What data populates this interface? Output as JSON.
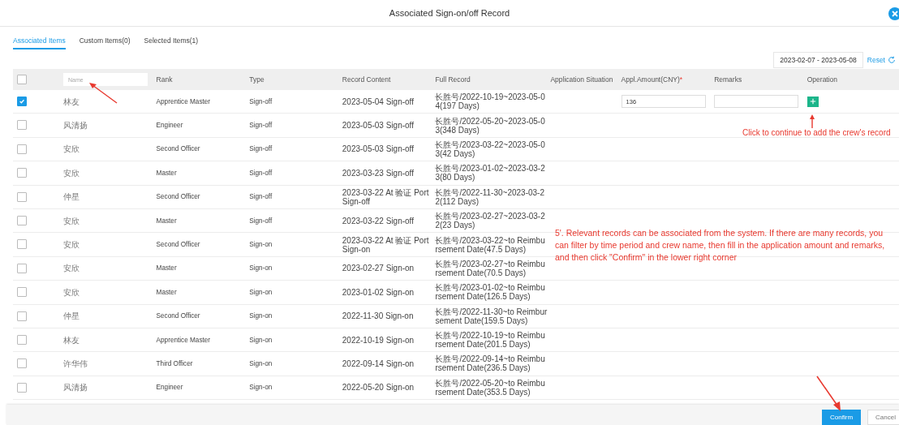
{
  "dialog": {
    "title": "Associated Sign-on/off Record"
  },
  "tabs": [
    {
      "label": "Associated Items",
      "selected": true
    },
    {
      "label": "Custom Items(0)",
      "selected": false
    },
    {
      "label": "Selected Items(1)",
      "selected": false
    }
  ],
  "date_range": {
    "value": "2023-02-07 - 2023-05-08"
  },
  "reset": {
    "label": "Reset"
  },
  "table": {
    "columns": [
      {
        "kind": "checkbox",
        "checked": false
      },
      {
        "kind": "filter",
        "placeholder": "Name"
      },
      {
        "kind": "text",
        "label": "Rank"
      },
      {
        "kind": "text",
        "label": "Type"
      },
      {
        "kind": "text",
        "label": "Record Content"
      },
      {
        "kind": "text",
        "label": "Full Record"
      },
      {
        "kind": "text",
        "label": "Application Situation"
      },
      {
        "kind": "text",
        "label": "Appl.Amount(CNY)",
        "mark": "*"
      },
      {
        "kind": "text",
        "label": "Remarks"
      },
      {
        "kind": "text",
        "label": "Operation"
      }
    ],
    "rows": [
      {
        "checked": true,
        "name": "林友",
        "rank": "Apprentice Master",
        "type": "Sign-off",
        "record_content": "2023-05-04 Sign-off",
        "full_record": "长胜号/2022-10-19~2023-05-04(197 Days)",
        "editable": true,
        "amount": "136"
      },
      {
        "checked": false,
        "name": "风清扬",
        "rank": "Engineer",
        "type": "Sign-off",
        "record_content": "2023-05-03 Sign-off",
        "full_record": "长胜号/2022-05-20~2023-05-03(348 Days)",
        "editable": false
      },
      {
        "checked": false,
        "name": "安欣",
        "rank": "Second Officer",
        "type": "Sign-off",
        "record_content": "2023-05-03 Sign-off",
        "full_record": "长胜号/2023-03-22~2023-05-03(42 Days)",
        "editable": false
      },
      {
        "checked": false,
        "name": "安欣",
        "rank": "Master",
        "type": "Sign-off",
        "record_content": "2023-03-23 Sign-off",
        "full_record": "长胜号/2023-01-02~2023-03-23(80 Days)",
        "editable": false
      },
      {
        "checked": false,
        "name": "仲星",
        "rank": "Second Officer",
        "type": "Sign-off",
        "record_content": "2023-03-22 At 验证 Port Sign-off",
        "full_record": "长胜号/2022-11-30~2023-03-22(112 Days)",
        "editable": false
      },
      {
        "checked": false,
        "name": "安欣",
        "rank": "Master",
        "type": "Sign-off",
        "record_content": "2023-03-22 Sign-off",
        "full_record": "长胜号/2023-02-27~2023-03-22(23 Days)",
        "editable": false
      },
      {
        "checked": false,
        "name": "安欣",
        "rank": "Second Officer",
        "type": "Sign-on",
        "record_content": "2023-03-22 At 验证 Port Sign-on",
        "full_record": "长胜号/2023-03-22~to Reimbursement Date(47.5 Days)",
        "editable": false
      },
      {
        "checked": false,
        "name": "安欣",
        "rank": "Master",
        "type": "Sign-on",
        "record_content": "2023-02-27 Sign-on",
        "full_record": "长胜号/2023-02-27~to Reimbursement Date(70.5 Days)",
        "editable": false
      },
      {
        "checked": false,
        "name": "安欣",
        "rank": "Master",
        "type": "Sign-on",
        "record_content": "2023-01-02 Sign-on",
        "full_record": "长胜号/2023-01-02~to Reimbursement Date(126.5 Days)",
        "editable": false
      },
      {
        "checked": false,
        "name": "仲星",
        "rank": "Second Officer",
        "type": "Sign-on",
        "record_content": "2022-11-30 Sign-on",
        "full_record": "长胜号/2022-11-30~to Reimbursement Date(159.5 Days)",
        "editable": false
      },
      {
        "checked": false,
        "name": "林友",
        "rank": "Apprentice Master",
        "type": "Sign-on",
        "record_content": "2022-10-19 Sign-on",
        "full_record": "长胜号/2022-10-19~to Reimbursement Date(201.5 Days)",
        "editable": false
      },
      {
        "checked": false,
        "name": "许华伟",
        "rank": "Third Officer",
        "type": "Sign-on",
        "record_content": "2022-09-14 Sign-on",
        "full_record": "长胜号/2022-09-14~to Reimbursement Date(236.5 Days)",
        "editable": false
      },
      {
        "checked": false,
        "name": "风清扬",
        "rank": "Engineer",
        "type": "Sign-on",
        "record_content": "2022-05-20 Sign-on",
        "full_record": "长胜号/2022-05-20~to Reimbursement Date(353.5 Days)",
        "editable": false
      }
    ]
  },
  "footer": {
    "buttons": [
      "Confirm",
      "Cancel"
    ]
  },
  "annotations": [
    {
      "kind": "hint",
      "text": "Click to continue to add the crew's record"
    },
    {
      "kind": "note",
      "text": "5'. Relevant records can be associated from the system. If there are many records, you can filter by time period and crew name, then fill in the application amount and remarks, and then click \"Confirm\" in the lower right corner"
    }
  ]
}
